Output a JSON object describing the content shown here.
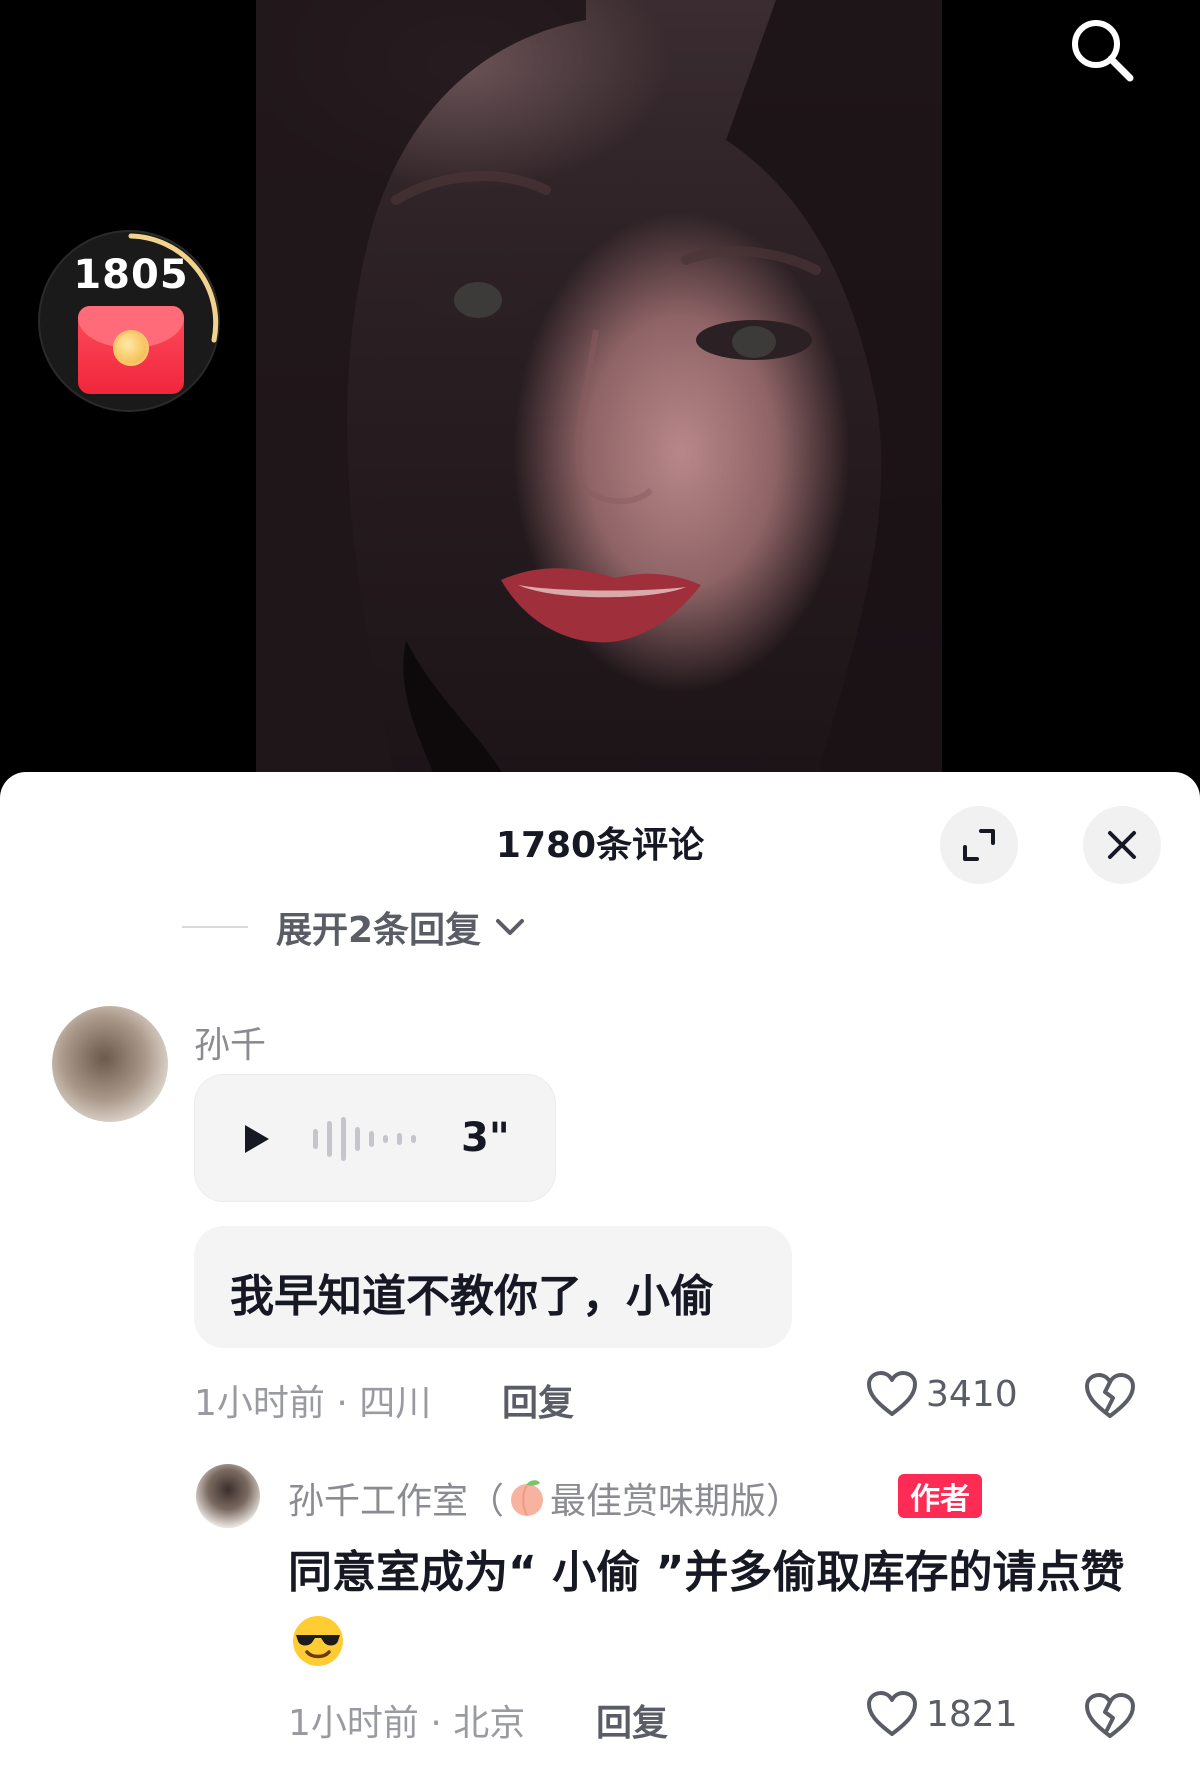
{
  "video": {
    "redpacket_count": "1805"
  },
  "comments_panel": {
    "title": "1780条评论",
    "expand_replies_label": "展开2条回复"
  },
  "comment": {
    "username": "孙千",
    "voice_duration": "3\"",
    "text": "我早知道不教你了，小偷",
    "time_location": "1小时前 · 四川",
    "reply_label": "回复",
    "like_count": "3410"
  },
  "reply": {
    "username_prefix": "孙千工作室（",
    "username_suffix": "最佳赏味期版）",
    "author_badge": "作者",
    "text": "同意室成为“ 小偷 ”并多偷取库存的请点赞",
    "time_location": "1小时前 · 北京",
    "reply_label": "回复",
    "like_count": "1821"
  },
  "colors": {
    "accent_red": "#fe2c55",
    "text_primary": "#161823",
    "text_secondary": "#8b8c92"
  },
  "icons": [
    "search-icon",
    "red-packet-icon",
    "expand-icon",
    "close-icon",
    "chevron-down-icon",
    "play-icon",
    "waveform-icon",
    "heart-icon",
    "broken-heart-icon",
    "peach-emoji",
    "cool-emoji"
  ]
}
